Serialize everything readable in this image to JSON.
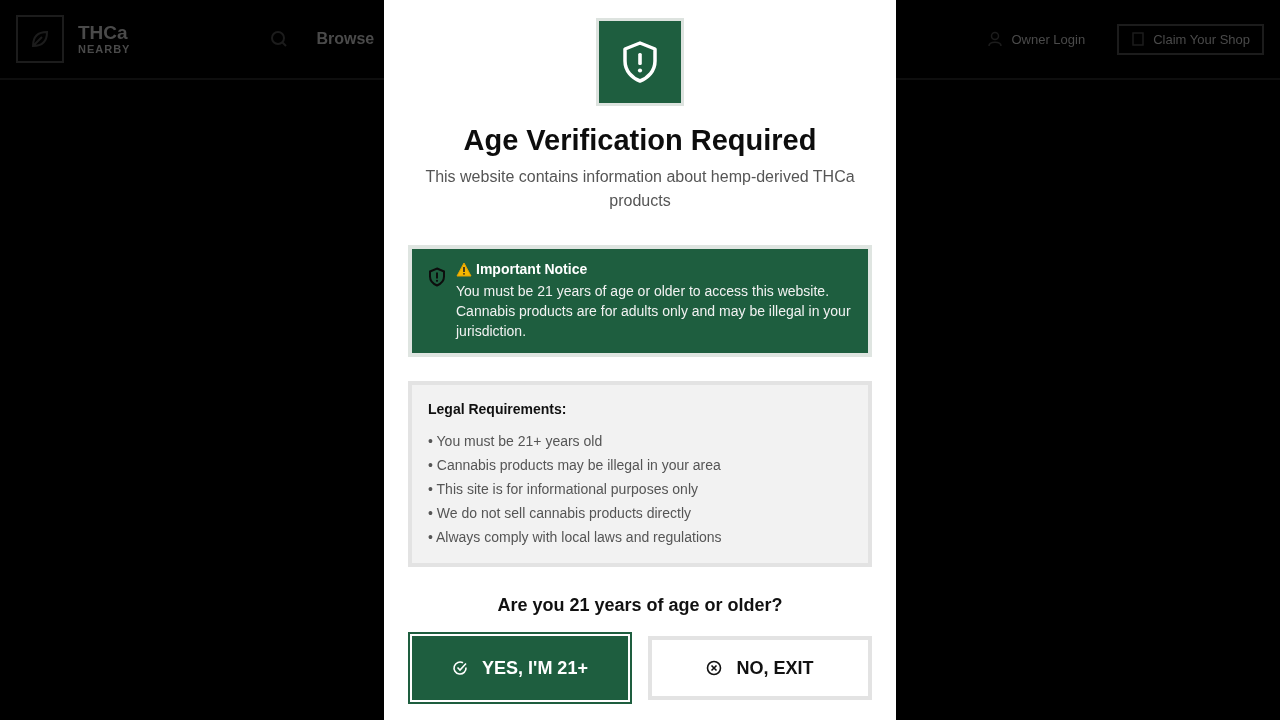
{
  "header": {
    "brand": "THCa",
    "brand_sub": "NEARBY",
    "nav": [
      "Browse"
    ],
    "owner_login": "Owner Login",
    "claim_button": "Claim Your Shop"
  },
  "modal": {
    "title": "Age Verification Required",
    "subtitle": "This website contains information about hemp-derived THCa products",
    "notice": {
      "title": "Important Notice",
      "body": "You must be 21 years of age or older to access this website. Cannabis products are for adults only and may be illegal in your jurisdiction."
    },
    "legal": {
      "title": "Legal Requirements:",
      "items": [
        "• You must be 21+ years old",
        "• Cannabis products may be illegal in your area",
        "• This site is for informational purposes only",
        "• We do not sell cannabis products directly",
        "• Always comply with local laws and regulations"
      ]
    },
    "question": "Are you 21 years of age or older?",
    "buttons": [
      {
        "label": "YES, I'M 21+",
        "kind": "confirm"
      },
      {
        "label": "NO, EXIT",
        "kind": "exit"
      }
    ]
  }
}
